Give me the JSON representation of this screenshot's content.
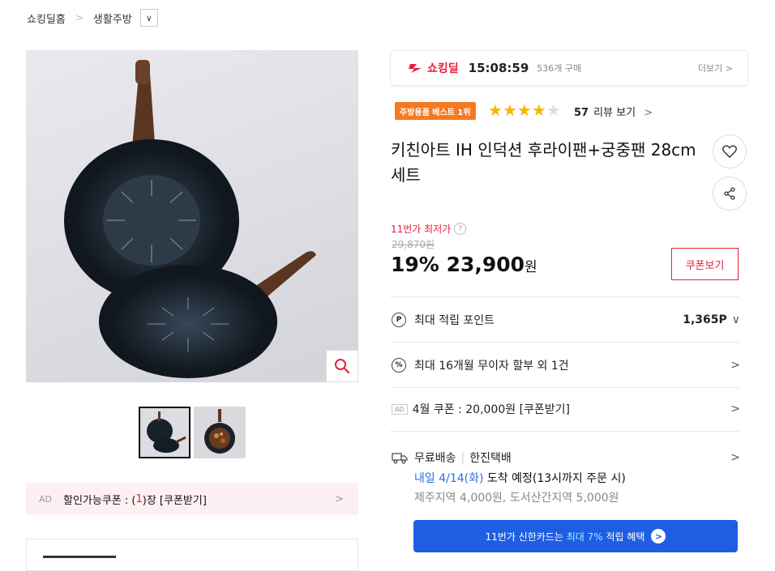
{
  "breadcrumb": {
    "home": "쇼킹딜홈",
    "category": "생활주방"
  },
  "shocking_deal": {
    "logo": "쇼킹딜",
    "timer": "15:08:59",
    "sold": "536개 구매",
    "more": "더보기"
  },
  "badge": "주방용품 베스트 1위",
  "rating": {
    "stars": 4,
    "max": 5,
    "count": "57",
    "review_label": "리뷰 보기"
  },
  "product": {
    "title": "키친아트 IH 인덕션 후라이팬+궁중팬 28cm 세트"
  },
  "price": {
    "lowest_label": "11번가 최저가",
    "original": "29,870원",
    "discount": "19%",
    "current": "23,900",
    "unit": "원",
    "coupon_button": "쿠폰보기"
  },
  "benefits": [
    {
      "label": "최대 적립 포인트",
      "value": "1,365P"
    },
    {
      "label": "최대 16개월 무이자 할부 외 1건"
    },
    {
      "ad": "AD",
      "label": "4월 쿠폰 : 20,000원 [쿠폰받기]"
    }
  ],
  "shipping": {
    "free": "무료배송",
    "carrier": "한진택배",
    "arrival_date": "내일 4/14(화)",
    "arrival_text": "도착 예정",
    "arrival_note": "(13시까지 주문 시)",
    "extra": "제주지역 4,000원, 도서산간지역 5,000원"
  },
  "card_promo": {
    "prefix": "11번가 신한카드는",
    "highlight": "최대 7%",
    "suffix": "적립 혜택"
  },
  "coupon_bar": {
    "ad": "AD",
    "pre": "할인가능쿠폰 : (",
    "count": "1",
    "post": ")장 [쿠폰받기]"
  },
  "colors": {
    "accent_red": "#e61e3c",
    "best_orange": "#f47a22",
    "star_gold": "#f8b500",
    "blue": "#1f5ee3"
  }
}
